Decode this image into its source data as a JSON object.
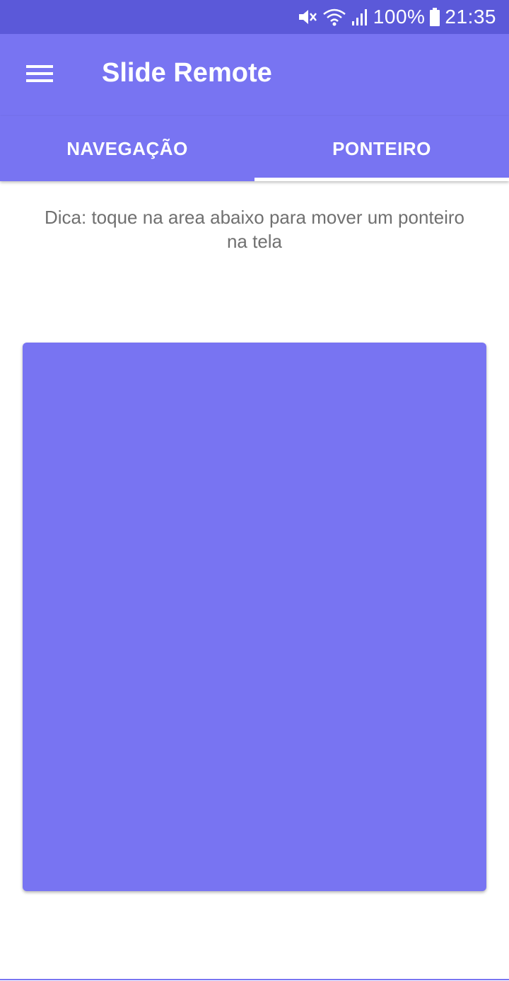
{
  "status_bar": {
    "battery_percent": "100%",
    "time": "21:35",
    "icons": [
      "mute-icon",
      "wifi-icon",
      "signal-icon",
      "battery-icon"
    ]
  },
  "app_bar": {
    "title": "Slide Remote",
    "menu_icon": "hamburger-menu-icon"
  },
  "tabs": [
    {
      "label": "NAVEGAÇÃO",
      "active": false
    },
    {
      "label": "PONTEIRO",
      "active": true
    }
  ],
  "hint": {
    "text": "Dica: toque na area abaixo para mover um ponteiro na tela"
  },
  "colors": {
    "status_bar": "#5b59d9",
    "primary": "#7874f2",
    "hint_text": "#707070"
  }
}
